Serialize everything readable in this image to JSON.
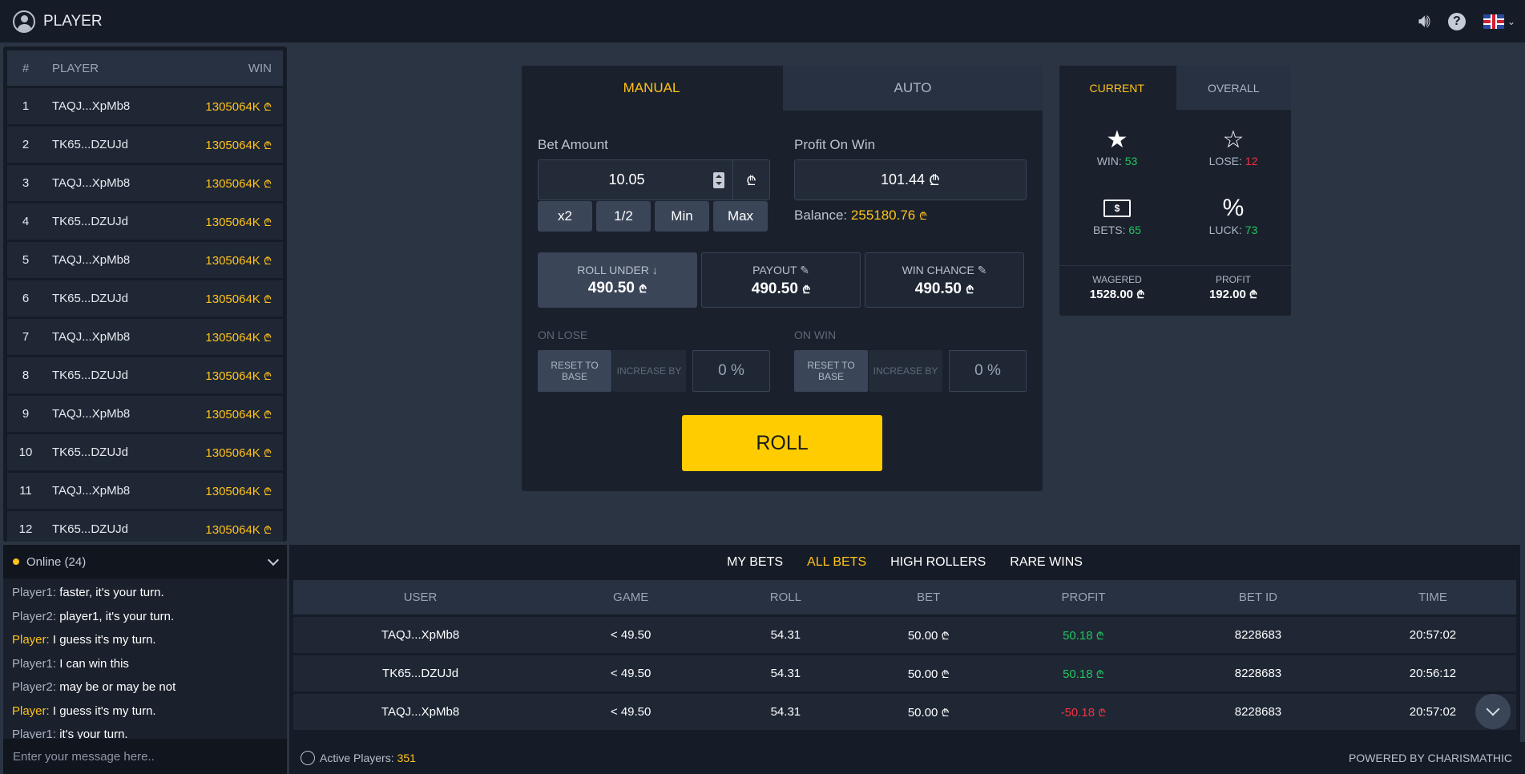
{
  "topbar": {
    "username": "PLAYER"
  },
  "leaderboard": {
    "headers": {
      "num": "#",
      "player": "PLAYER",
      "win": "WIN"
    },
    "rows": [
      {
        "n": "1",
        "player": "TAQJ...XpMb8",
        "win": "1305064K"
      },
      {
        "n": "2",
        "player": "TK65...DZUJd",
        "win": "1305064K"
      },
      {
        "n": "3",
        "player": "TAQJ...XpMb8",
        "win": "1305064K"
      },
      {
        "n": "4",
        "player": "TK65...DZUJd",
        "win": "1305064K"
      },
      {
        "n": "5",
        "player": "TAQJ...XpMb8",
        "win": "1305064K"
      },
      {
        "n": "6",
        "player": "TK65...DZUJd",
        "win": "1305064K"
      },
      {
        "n": "7",
        "player": "TAQJ...XpMb8",
        "win": "1305064K"
      },
      {
        "n": "8",
        "player": "TK65...DZUJd",
        "win": "1305064K"
      },
      {
        "n": "9",
        "player": "TAQJ...XpMb8",
        "win": "1305064K"
      },
      {
        "n": "10",
        "player": "TK65...DZUJd",
        "win": "1305064K"
      },
      {
        "n": "11",
        "player": "TAQJ...XpMb8",
        "win": "1305064K"
      },
      {
        "n": "12",
        "player": "TK65...DZUJd",
        "win": "1305064K"
      }
    ]
  },
  "chat": {
    "online_label": "Online (24)",
    "messages": [
      {
        "who": "Player1:",
        "text": "faster, it's your turn.",
        "me": false
      },
      {
        "who": "Player2:",
        "text": "player1, it's your turn.",
        "me": false
      },
      {
        "who": "Player:",
        "text": "I guess it's my turn.",
        "me": true
      },
      {
        "who": "Player1:",
        "text": "I can win this",
        "me": false
      },
      {
        "who": "Player2:",
        "text": "may be or may be not",
        "me": false
      },
      {
        "who": "Player:",
        "text": "I guess it's my turn.",
        "me": true
      },
      {
        "who": "Player1:",
        "text": "it's your turn.",
        "me": false
      }
    ],
    "input_placeholder": "Enter your message here.."
  },
  "game": {
    "tabs": [
      "MANUAL",
      "AUTO"
    ],
    "bet_amount_label": "Bet Amount",
    "bet_amount_value": "10.05",
    "profit_label": "Profit On Win",
    "profit_value": "101.44",
    "quick_buttons": [
      "x2",
      "1/2",
      "Min",
      "Max"
    ],
    "balance_label": "Balance:",
    "balance_value": "255180.76",
    "stats": [
      {
        "title": "ROLL UNDER",
        "value": "490.50"
      },
      {
        "title": "PAYOUT",
        "value": "490.50"
      },
      {
        "title": "WIN CHANCE",
        "value": "490.50"
      }
    ],
    "on_lose": {
      "label": "ON LOSE",
      "reset": "RESET TO BASE",
      "increase": "INCREASE BY",
      "pct": "0 %"
    },
    "on_win": {
      "label": "ON WIN",
      "reset": "RESET TO BASE",
      "increase": "INCREASE BY",
      "pct": "0 %"
    },
    "roll_label": "ROLL"
  },
  "statspanel": {
    "tabs": [
      "CURRENT",
      "OVERALL"
    ],
    "win_label": "WIN:",
    "win_value": "53",
    "lose_label": "LOSE:",
    "lose_value": "12",
    "bets_label": "BETS:",
    "bets_value": "65",
    "luck_label": "LUCK:",
    "luck_value": "73",
    "luck_symbol": "%",
    "wagered_label": "WAGERED",
    "wagered_value": "1528.00",
    "profit_label": "PROFIT",
    "profit_value": "192.00"
  },
  "bets": {
    "tabs": [
      "MY BETS",
      "ALL BETS",
      "HIGH ROLLERS",
      "RARE WINS"
    ],
    "headers": [
      "USER",
      "GAME",
      "ROLL",
      "BET",
      "PROFIT",
      "BET ID",
      "TIME"
    ],
    "rows": [
      {
        "user": "TAQJ...XpMb8",
        "game": "< 49.50",
        "roll": "54.31",
        "bet": "50.00",
        "profit": "50.18",
        "positive": true,
        "id": "8228683",
        "time": "20:57:02"
      },
      {
        "user": "TK65...DZUJd",
        "game": "< 49.50",
        "roll": "54.31",
        "bet": "50.00",
        "profit": "50.18",
        "positive": true,
        "id": "8228683",
        "time": "20:56:12"
      },
      {
        "user": "TAQJ...XpMb8",
        "game": "< 49.50",
        "roll": "54.31",
        "bet": "50.00",
        "profit": "-50.18",
        "positive": false,
        "id": "8228683",
        "time": "20:57:02"
      }
    ]
  },
  "footer": {
    "active_label": "Active Players:",
    "active_value": "351",
    "powered": "POWERED BY CHARISMATHIC"
  },
  "currency_symbol": "₾",
  "colors": {
    "accent": "#ffc21a",
    "roll": "#ffcc00",
    "win": "#22c55e",
    "loss": "#ef3340"
  }
}
